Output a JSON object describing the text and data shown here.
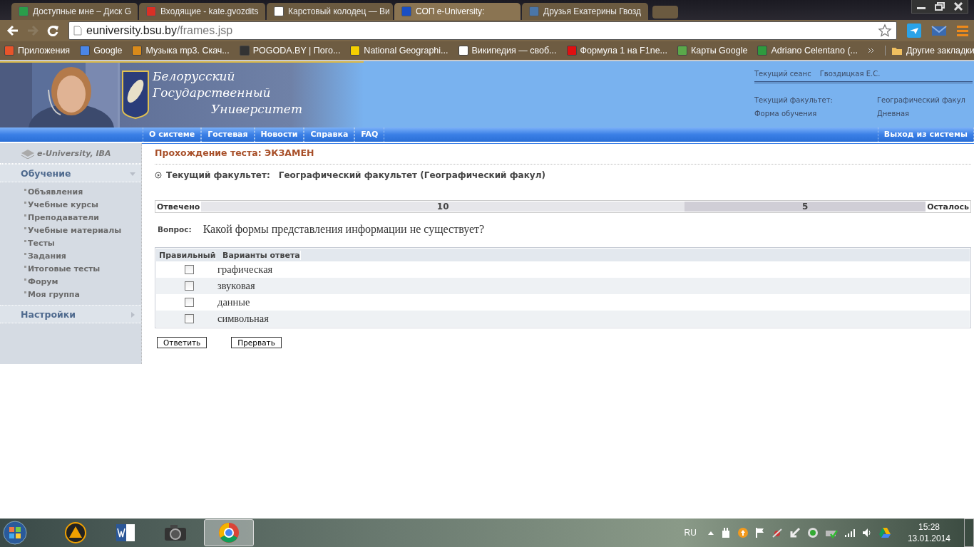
{
  "browser": {
    "tabs": [
      {
        "title": "Доступные мне – Диск G",
        "selected": false,
        "color": "#2a9d4a"
      },
      {
        "title": "Входящие - kate.gvozdits",
        "selected": false,
        "color": "#d93025"
      },
      {
        "title": "Карстовый колодец — Ви",
        "selected": false,
        "color": "#ffffff"
      },
      {
        "title": "СОП e-University:",
        "selected": true,
        "color": "#1a4fc4"
      },
      {
        "title": "Друзья Екатерины Гвозд",
        "selected": false,
        "color": "#4a76a8"
      }
    ],
    "address": {
      "host": "euniversity.bsu.by",
      "path": "/frames.jsp"
    },
    "bookmarks": [
      {
        "label": "Приложения",
        "color": "#e8542a"
      },
      {
        "label": "Google",
        "color": "#4a86e8"
      },
      {
        "label": "Музыка mp3. Скач...",
        "color": "#d98a1a"
      },
      {
        "label": "POGODA.BY | Пого...",
        "color": "#333333"
      },
      {
        "label": "National Geographi...",
        "color": "#f5d000"
      },
      {
        "label": "Википедия — своб...",
        "color": "#ffffff"
      },
      {
        "label": "Формула 1 на F1ne...",
        "color": "#e01010"
      },
      {
        "label": "Карты Google",
        "color": "#5aa84a"
      },
      {
        "label": "Adriano Celentano (...",
        "color": "#2e9a3e"
      }
    ],
    "other_bookmarks": "Другие закладки"
  },
  "header": {
    "crest_lines": [
      "Белорусский",
      "Государственный",
      "Университет"
    ],
    "session_label": "Текущий сеанс",
    "session_user": "Гвоздицкая Е.С.",
    "faculty_label": "Текущий факультет:",
    "faculty_value": "Географический факул",
    "form_label": "Форма обучения",
    "form_value": "Дневная"
  },
  "nav": [
    "О системе",
    "Гостевая",
    "Новости",
    "Справка",
    "FAQ"
  ],
  "logout": "Выход из системы",
  "sidebar": {
    "logo": "e-University, IBA",
    "sections": [
      {
        "label": "Обучение",
        "expanded": true,
        "items": [
          "Объявления",
          "Учебные курсы",
          "Преподаватели",
          "Учебные материалы",
          "Тесты",
          "Задания",
          "Итоговые тесты",
          "Форум",
          "Моя группа"
        ]
      },
      {
        "label": "Настройки",
        "expanded": false
      }
    ]
  },
  "content": {
    "title": "Прохождение теста: ЭКЗАМЕН",
    "faculty_label": "Текущий факультет:",
    "faculty_value": "Географический факультет (Географический факул)",
    "progress": {
      "answered_label": "Отвечено",
      "answered": "10",
      "remaining": "5",
      "remaining_label": "Осталось",
      "level": 0.667
    },
    "question_label": "Вопрос:",
    "question": "Какой формы представления информации не существует?",
    "columns": [
      "Правильный",
      "Варианты ответа"
    ],
    "answers": [
      {
        "text": "графическая",
        "checked": false
      },
      {
        "text": "звуковая",
        "checked": false
      },
      {
        "text": "данные",
        "checked": false
      },
      {
        "text": "символьная",
        "checked": false
      }
    ],
    "buttons": [
      "Ответить",
      "Прервать"
    ]
  },
  "taskbar": {
    "apps": [
      {
        "kind": "triangle",
        "selected": false
      },
      {
        "kind": "word",
        "selected": false
      },
      {
        "kind": "camera",
        "selected": false
      },
      {
        "kind": "chrome",
        "selected": true
      }
    ],
    "lang": "RU",
    "time": "15:28",
    "date": "13.01.2014"
  }
}
